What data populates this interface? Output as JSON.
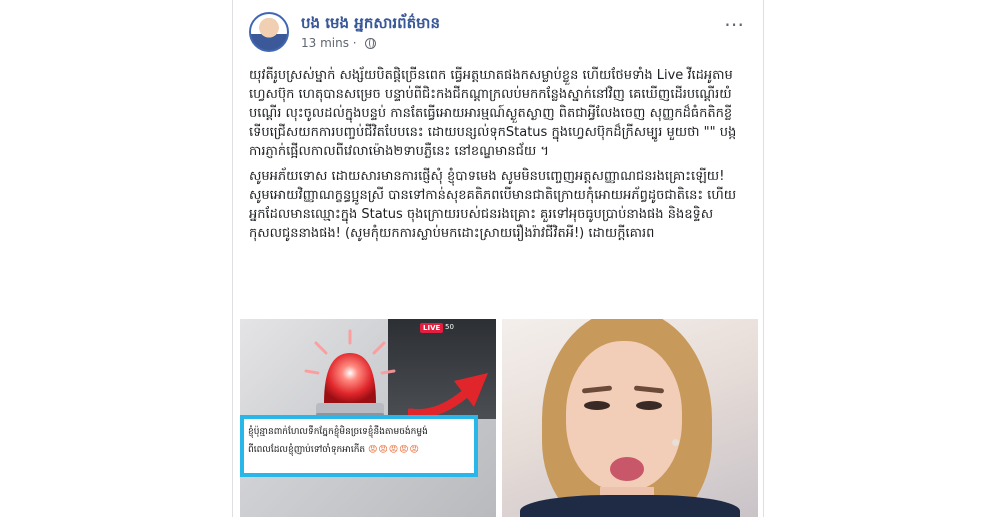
{
  "post": {
    "author": "បង មេង អ្នកសារព័ត៌មាន",
    "time": "13 mins",
    "paragraphs": [
      "យុវតីរូបស្រស់ម្នាក់ សង្ស័យបិតផ្ដិច្រើនពេក ធ្វើអត្តឃាតផងកសម្លាប់ខ្លួន ហើយថែមទាំង Live វីដេអូតាមហ្វេសប៊ុក ហេតុបានសម្រេច បន្ទាប់ពីជិះកងជីកណ្ដាក្រលប់មកកន្លែងស្នាក់នៅវិញ គេឃើញដើរបណ្ដើរយំបណ្ដើរ លុះចូលដល់ក្នុងបន្ទប់ កានតែធ្វើអោយអារម្មណ៍ស្ងួតស្ងាញ ពិតជាអ្វីលែងចេញ សុញ្ញកដ៏ធំកតិកខ្លី ទើបជ្រើសយកការបញ្ចប់ជីវិតបែបនេះ ដោយបន្សល់ទុកStatus ក្នុងហ្វេសប៊ុកដ៏ក្រីសម្បូរ មួយថា \"\" បង្កការភ្ញាក់ផ្អើលកាលពីវេលាម៉ោង២ទាបភ្លឺនេះ នៅខណ្ឌមានជ័យ ។",
      "សូមអភ័យទោស ដោយសារមានការផ្ញើសុំ ខ្ញុំបាទមេង សូមមិនបញ្ចេញអត្តសញ្ញាណជនរងគ្រោះឡើយ! សូមអោយវិញ្ញាណក្ខន្ធប្អូនស្រី បានទៅកាន់សុខគតិភពបើមានជាតិក្រោយកុំអោយអភ័ព្វដូចជាតិនេះ ហើយអ្នកដែលមានឈ្មោះក្នុង Status ចុងក្រោយរបស់ជនរងគ្រោះ គួរទៅអុចធូបប្រាប់នាងផង និងឧទ្ទិសកុសលជូននាងផង! (សូមកុំយកការស្លាប់មកដោះស្រាយរឿងរ៉ាវជីវិតអី!) ដោយក្ដីគោរព"
    ]
  },
  "media": {
    "live_badge": "LIVE",
    "viewers": "50",
    "screenshot_line1": "ខ្ញុំប៉ុន្មានពាក់ហែលទឹកភ្នែកខ្ញុំមិនច្រទេខ្ញុំនឹងតាមចង់កម្ចង់",
    "screenshot_line2": "ពីពេលដែលខ្ញុំញាប់ទៅចាំទុកអាកើត",
    "screenshot_emojis": "😡😡😡😡😡"
  },
  "icons": {
    "options": "options-icon",
    "privacy": "globe-icon",
    "siren": "siren-icon",
    "arrow": "arrow-icon"
  },
  "colors": {
    "author_link": "#385898",
    "meta": "#606770",
    "text": "#1c1e21",
    "siren_red": "#e0262b",
    "screenshot_border": "#29b6e8"
  }
}
